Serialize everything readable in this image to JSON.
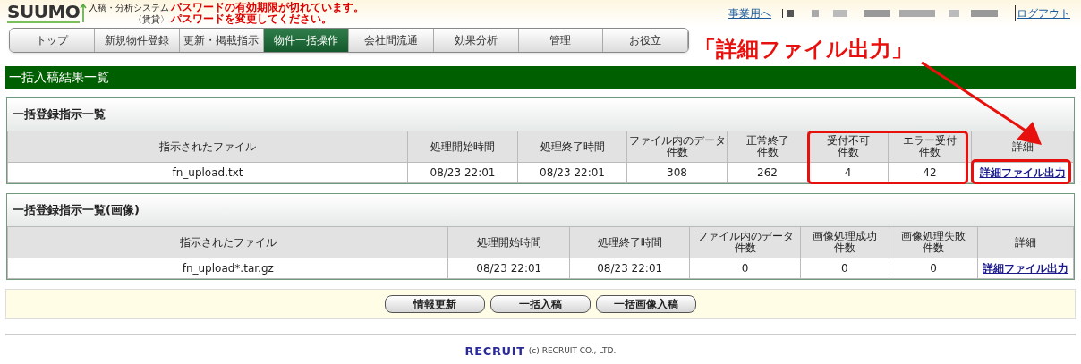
{
  "header": {
    "logo": "SUUMO",
    "system_name": "入稿・分析システム",
    "system_sub": "〈賃貸〉",
    "alerts": [
      "パスワードの有効期限が切れています。",
      "パスワードを変更してください。"
    ],
    "business_link": "事業用へ",
    "logout_link": "ログアウト"
  },
  "tabs": [
    {
      "label": "トップ",
      "selected": false
    },
    {
      "label": "新規物件登録",
      "selected": false
    },
    {
      "label": "更新・掲載指示",
      "selected": false
    },
    {
      "label": "物件一括操作",
      "selected": true
    },
    {
      "label": "会社間流通",
      "selected": false
    },
    {
      "label": "効果分析",
      "selected": false
    },
    {
      "label": "管理",
      "selected": false
    },
    {
      "label": "お役立",
      "selected": false
    }
  ],
  "page_title": "一括入稿結果一覧",
  "sections": [
    {
      "title": "一括登録指示一覧",
      "columns": [
        "指示されたファイル",
        "処理開始時間",
        "処理終了時間",
        "ファイル内のデータ件数",
        "正常終了件数",
        "受付不可件数",
        "エラー受付件数",
        "詳細"
      ],
      "rows": [
        {
          "cells": [
            "fn_upload.txt",
            "08/23 22:01",
            "08/23 22:01",
            "308",
            "262",
            "4",
            "42"
          ],
          "detail_link": "詳細ファイル出力"
        }
      ]
    },
    {
      "title": "一括登録指示一覧(画像)",
      "columns": [
        "指示されたファイル",
        "処理開始時間",
        "処理終了時間",
        "ファイル内のデータ件数",
        "画像処理成功件数",
        "画像処理失敗件数",
        "詳細"
      ],
      "rows": [
        {
          "cells": [
            "fn_upload*.tar.gz",
            "08/23 22:01",
            "08/23 22:01",
            "0",
            "0",
            "0"
          ],
          "detail_link": "詳細ファイル出力"
        }
      ]
    }
  ],
  "buttons": [
    "情報更新",
    "一括入稿",
    "一括画像入稿"
  ],
  "footer": {
    "logo": "RECRUIT",
    "copyright": "(c) RECRUIT CO., LTD."
  },
  "annotation": {
    "callout": "「詳細ファイル出力」"
  }
}
